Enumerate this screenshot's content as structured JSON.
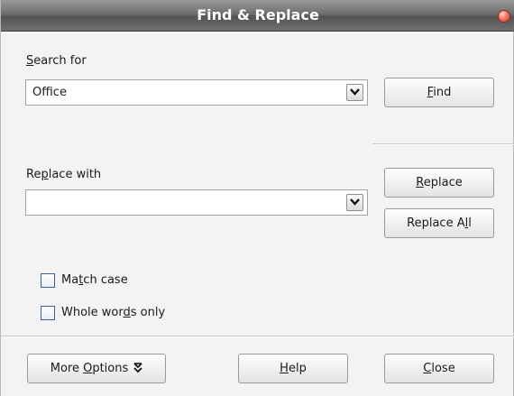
{
  "window": {
    "title": "Find & Replace"
  },
  "search": {
    "label_pre": "",
    "label_key": "S",
    "label_post": "earch for",
    "value": "Office"
  },
  "replace": {
    "label_pre": "Re",
    "label_key": "p",
    "label_post": "lace with",
    "value": ""
  },
  "buttons": {
    "find": {
      "pre": "",
      "key": "F",
      "post": "ind"
    },
    "replace": {
      "pre": "",
      "key": "R",
      "post": "eplace"
    },
    "replace_all": {
      "pre": "Replace A",
      "key": "l",
      "post": "l"
    },
    "more_options": {
      "pre": "More ",
      "key": "O",
      "post": "ptions"
    },
    "help": {
      "pre": "",
      "key": "H",
      "post": "elp"
    },
    "close": {
      "pre": "",
      "key": "C",
      "post": "lose"
    }
  },
  "options": {
    "match_case": {
      "pre": "Ma",
      "key": "t",
      "post": "ch case",
      "checked": false
    },
    "whole_words": {
      "pre": "Whole wor",
      "key": "d",
      "post": "s only",
      "checked": false
    }
  },
  "icons": {
    "dropdown": "chevron-down-icon",
    "more": "double-chevron-down-icon",
    "close": "close-icon"
  },
  "colors": {
    "titlebar": "#6e6e6e",
    "background": "#f3f3f3",
    "close_orb": "#e05a40"
  }
}
